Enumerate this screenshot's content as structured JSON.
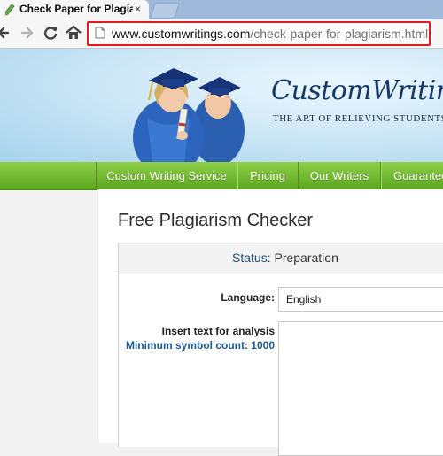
{
  "browser": {
    "tab_title": "Check Paper for Plagiarism",
    "tab_close": "×",
    "url_host": "www.customwritings.com",
    "url_path": "/check-paper-for-plagiarism.html"
  },
  "header": {
    "logo": "CustomWritings.c",
    "tagline": "THE ART OF RELIEVING STUDENTS"
  },
  "nav": {
    "items": [
      {
        "label": "Custom Writing Service"
      },
      {
        "label": "Pricing"
      },
      {
        "label": "Our Writers"
      },
      {
        "label": "Guarantee"
      }
    ]
  },
  "main": {
    "title": "Free Plagiarism Checker",
    "status_label": "Status:",
    "status_value": "Preparation",
    "language_label": "Language:",
    "language_value": "English",
    "text_label": "Insert text for analysis",
    "min_count_label": "Minimum symbol count: 1000"
  },
  "colors": {
    "nav_green": "#6cb52f",
    "url_highlight": "#e01b22",
    "status_blue": "#1f4f78"
  }
}
